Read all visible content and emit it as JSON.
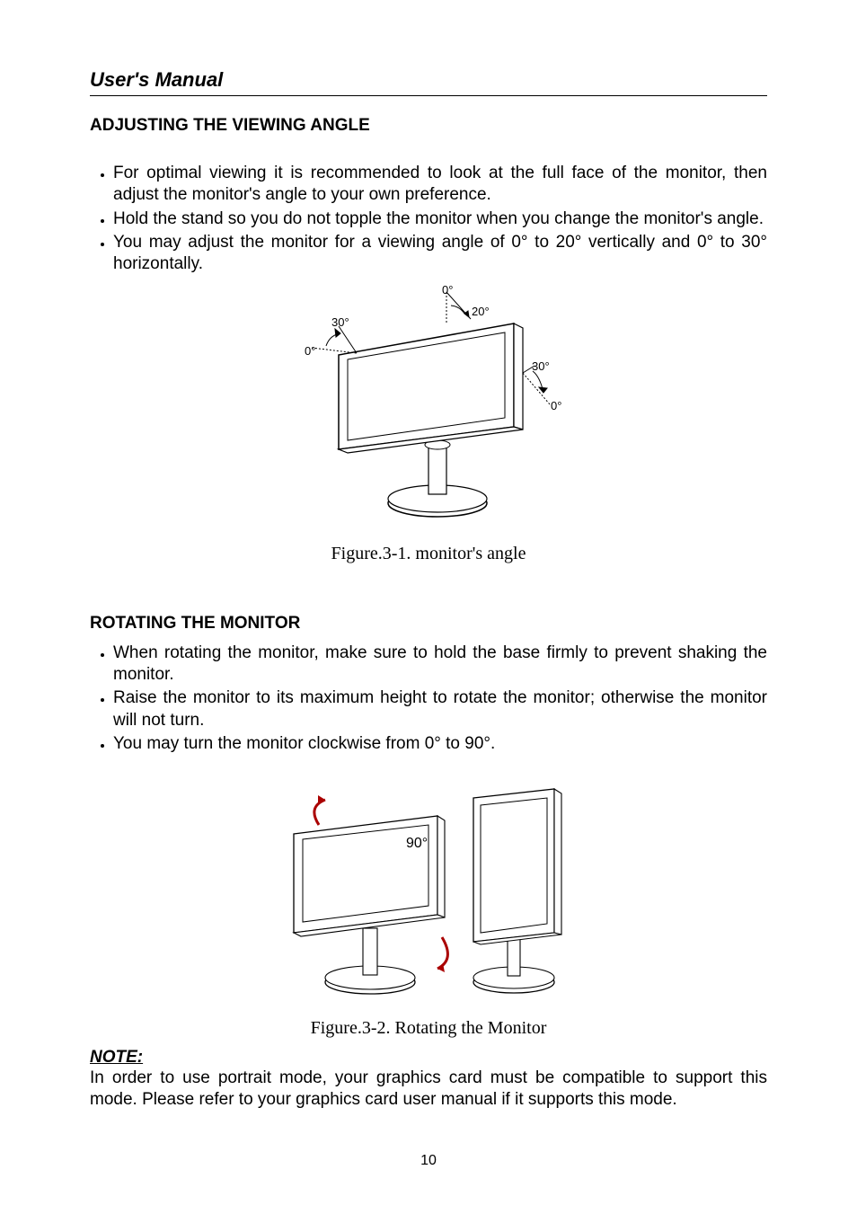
{
  "header": {
    "title": "User's Manual"
  },
  "section1": {
    "heading": "ADJUSTING THE VIEWING ANGLE",
    "bullets": [
      "For optimal viewing it is recommended to look at the full face of the monitor, then adjust the monitor's angle to your own preference.",
      "Hold the stand so you do not topple the monitor when you change the monitor's angle.",
      "You may adjust the monitor for a viewing angle of 0° to 20° vertically and 0° to 30° horizontally."
    ]
  },
  "figure1": {
    "caption": "Figure.3-1. monitor's angle",
    "labels": {
      "top_left_0": "0°",
      "top_left_30": "30°",
      "top_center_0": "0°",
      "top_center_20": "20°",
      "right_30": "30°",
      "right_0": "0°"
    }
  },
  "section2": {
    "heading": "ROTATING THE MONITOR",
    "bullets": [
      "When rotating the monitor, make sure to hold the base firmly to prevent shaking the monitor.",
      "Raise the monitor to its maximum height to rotate the monitor; otherwise the monitor will not turn.",
      "You may turn the monitor clockwise from 0° to 90°."
    ]
  },
  "figure2": {
    "caption": "Figure.3-2. Rotating the Monitor",
    "labels": {
      "angle": "90°"
    }
  },
  "note": {
    "heading": "NOTE:",
    "body": "In order to use portrait mode, your graphics card must be compatible to support this mode. Please refer to your graphics card user manual if it supports this mode."
  },
  "page_number": "10"
}
